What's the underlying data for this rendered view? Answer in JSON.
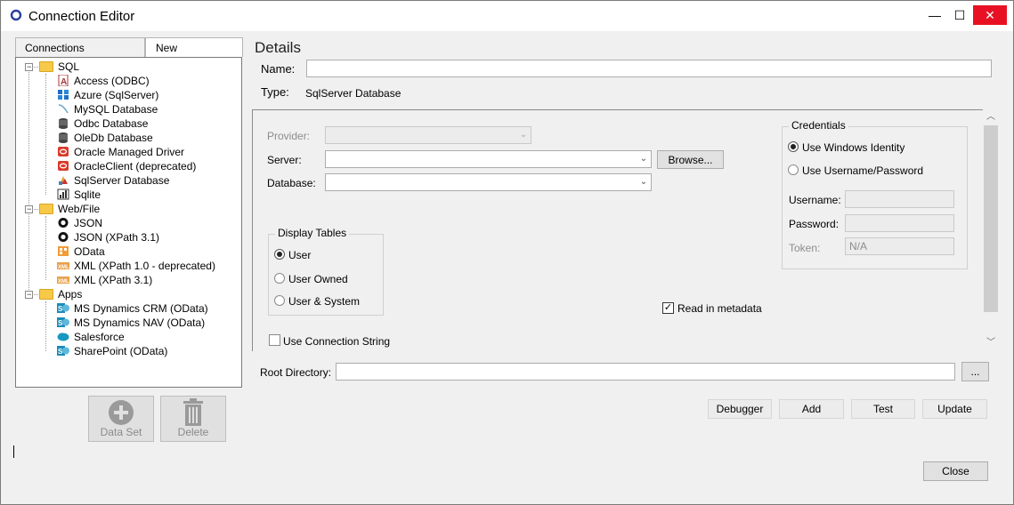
{
  "window": {
    "title": "Connection Editor",
    "controls": {
      "minimize": "—",
      "maximize": "☐",
      "close": "✕"
    }
  },
  "tabs": [
    {
      "label": "Connections"
    },
    {
      "label": "New"
    }
  ],
  "tree": {
    "groups": [
      {
        "label": "SQL",
        "expander": "−",
        "items": [
          {
            "label": "Access (ODBC)",
            "icon": "access-icon"
          },
          {
            "label": "Azure (SqlServer)",
            "icon": "azure-icon"
          },
          {
            "label": "MySQL Database",
            "icon": "mysql-icon"
          },
          {
            "label": "Odbc Database",
            "icon": "database-icon"
          },
          {
            "label": "OleDb Database",
            "icon": "database-icon"
          },
          {
            "label": "Oracle Managed Driver",
            "icon": "oracle-icon"
          },
          {
            "label": "OracleClient (deprecated)",
            "icon": "oracle-icon"
          },
          {
            "label": "SqlServer Database",
            "icon": "sqlserver-icon"
          },
          {
            "label": "Sqlite",
            "icon": "sqlite-icon"
          }
        ]
      },
      {
        "label": "Web/File",
        "expander": "−",
        "items": [
          {
            "label": "JSON",
            "icon": "json-icon"
          },
          {
            "label": "JSON (XPath 3.1)",
            "icon": "json-icon"
          },
          {
            "label": "OData",
            "icon": "odata-icon"
          },
          {
            "label": "XML (XPath 1.0 - deprecated)",
            "icon": "xml-icon"
          },
          {
            "label": "XML (XPath 3.1)",
            "icon": "xml-icon"
          }
        ]
      },
      {
        "label": "Apps",
        "expander": "−",
        "items": [
          {
            "label": "MS Dynamics CRM (OData)",
            "icon": "sharepoint-icon"
          },
          {
            "label": "MS Dynamics NAV (OData)",
            "icon": "sharepoint-icon"
          },
          {
            "label": "Salesforce",
            "icon": "salesforce-icon"
          },
          {
            "label": "SharePoint (OData)",
            "icon": "sharepoint-icon"
          }
        ]
      }
    ]
  },
  "left_buttons": {
    "dataset": "Data Set",
    "delete": "Delete"
  },
  "details": {
    "title": "Details",
    "name_label": "Name:",
    "name_value": "",
    "type_label": "Type:",
    "type_value": "SqlServer Database",
    "provider_label": "Provider:",
    "provider_value": "",
    "server_label": "Server:",
    "server_value": "",
    "browse_label": "Browse...",
    "database_label": "Database:",
    "database_value": "",
    "display_tables": {
      "title": "Display Tables",
      "options": [
        {
          "label": "User",
          "selected": true
        },
        {
          "label": "User Owned",
          "selected": false
        },
        {
          "label": "User & System",
          "selected": false
        }
      ]
    },
    "read_in_metadata": {
      "label": "Read in metadata",
      "checked": true
    },
    "use_connection_string": {
      "label": "Use Connection String",
      "checked": false
    },
    "credentials": {
      "title": "Credentials",
      "windows_identity": "Use Windows Identity",
      "username_password": "Use Username/Password",
      "username_label": "Username:",
      "username_value": "",
      "password_label": "Password:",
      "password_value": "",
      "token_label": "Token:",
      "token_value": "N/A"
    },
    "root_directory_label": "Root Directory:",
    "root_directory_value": "",
    "ellipsis_label": "..."
  },
  "actions": {
    "debugger": "Debugger",
    "add": "Add",
    "test": "Test",
    "update": "Update",
    "close": "Close"
  },
  "glyphs": {
    "check": "✓",
    "dropdown": "⌄",
    "scroll_up": "︿",
    "scroll_down": "﹀"
  }
}
